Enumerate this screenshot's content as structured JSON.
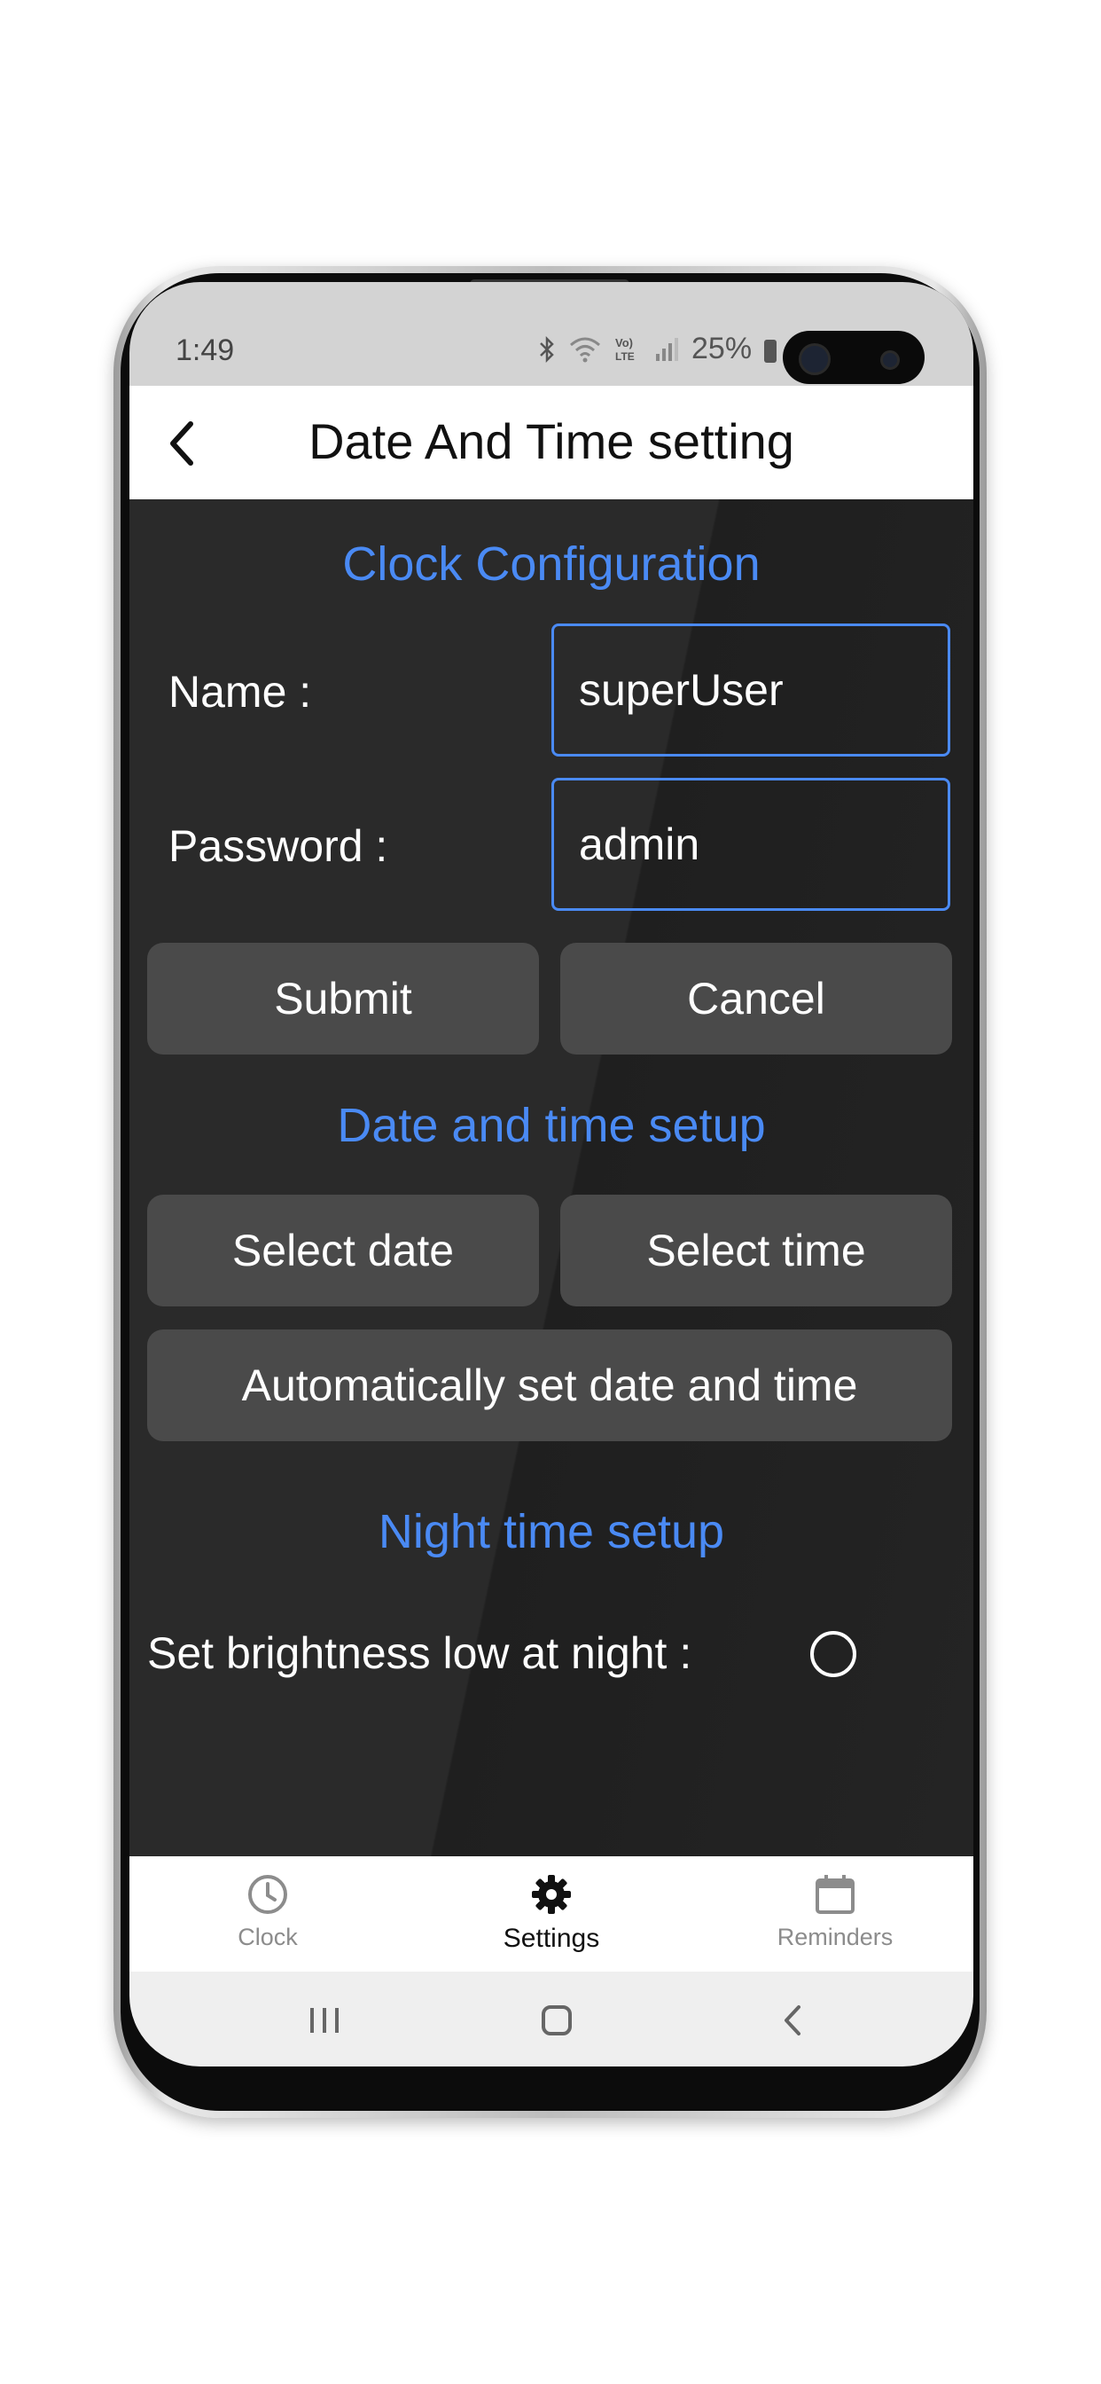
{
  "status_bar": {
    "time": "1:49",
    "battery_percent": "25%",
    "icons": [
      "bluetooth-icon",
      "wifi-icon",
      "volte-icon",
      "signal-icon",
      "battery-icon"
    ],
    "volte_label": "Vo)\nLTE"
  },
  "app_bar": {
    "title": "Date And Time setting",
    "back_icon": "chevron-left-icon"
  },
  "clock_config": {
    "title": "Clock Configuration",
    "name_label": "Name :",
    "name_value": "superUser",
    "password_label": "Password :",
    "password_value": "admin",
    "submit_label": "Submit",
    "cancel_label": "Cancel"
  },
  "date_time_setup": {
    "title": "Date and time setup",
    "select_date_label": "Select date",
    "select_time_label": "Select time",
    "auto_label": "Automatically set date and time"
  },
  "night_setup": {
    "title": "Night time setup",
    "brightness_label": "Set brightness low at night :",
    "brightness_low_checked": false
  },
  "bottom_nav": {
    "items": [
      {
        "label": "Clock",
        "icon": "clock-icon",
        "active": false
      },
      {
        "label": "Settings",
        "icon": "gear-icon",
        "active": true
      },
      {
        "label": "Reminders",
        "icon": "calendar-icon",
        "active": false
      }
    ]
  },
  "colors": {
    "accent": "#4a8af4",
    "background": "#242424",
    "button": "#4a4a4a"
  }
}
